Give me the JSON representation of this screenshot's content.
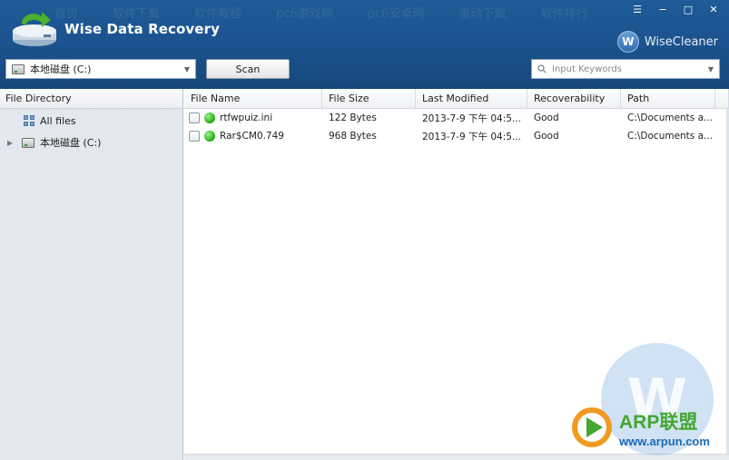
{
  "app": {
    "title": "Wise Data Recovery"
  },
  "brand": {
    "label": "WiseCleaner",
    "mark": "W"
  },
  "ghost_menu": [
    "首页",
    "软件下载",
    "软件教程",
    "pc6游戏网",
    "pc6安卓网",
    "驱动下载",
    "软件排行"
  ],
  "window_controls": {
    "menu": "☰",
    "minimize": "−",
    "maximize": "□",
    "close": "✕"
  },
  "toolbar": {
    "drive_select": "本地磁盘 (C:)",
    "scan_label": "Scan",
    "search_placeholder": "Input Keywords"
  },
  "left_panel": {
    "header": "File Directory",
    "all_files": "All files",
    "drive": "本地磁盘 (C:)"
  },
  "table": {
    "columns": [
      "File Name",
      "File Size",
      "Last Modified",
      "Recoverability",
      "Path"
    ],
    "rows": [
      {
        "name": "rtfwpuiz.ini",
        "size": "122 Bytes",
        "modified": "2013-7-9 下午 04:5...",
        "recoverability": "Good",
        "path": "C:\\Documents a..."
      },
      {
        "name": "Rar$CM0.749",
        "size": "968 Bytes",
        "modified": "2013-7-9 下午 04:5...",
        "recoverability": "Good",
        "path": "C:\\Documents a..."
      }
    ]
  },
  "watermark": {
    "letter": "W",
    "arp_title": "ARP联盟",
    "arp_url": "www.arpun.com"
  },
  "colors": {
    "header": "#1c5390",
    "status_good": "#2fb31f",
    "arp_green": "#45a631",
    "arp_blue": "#1b6ab1"
  }
}
